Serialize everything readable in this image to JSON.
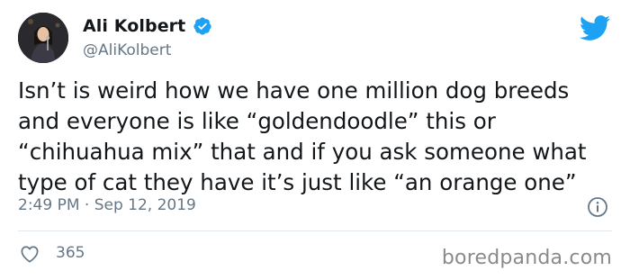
{
  "author": {
    "display_name": "Ali Kolbert",
    "handle": "@AliKolbert",
    "verified": true
  },
  "tweet": {
    "text": "Isn’t is weird how we have one million dog breeds\nand everyone is like “goldendoodle” this or\n“chihuahua mix” that and if you ask someone what\ntype of cat they have it’s just like “an orange one”",
    "timestamp": "2:49 PM · Sep 12, 2019",
    "like_count": "365"
  },
  "watermark": "boredpanda.com",
  "icons": {
    "brand": "twitter-bird-icon",
    "verified": "verified-badge-icon",
    "info": "info-icon",
    "like": "heart-icon"
  },
  "colors": {
    "twitter_blue": "#1da1f2",
    "text_primary": "#14171a",
    "text_secondary": "#657786",
    "divider": "#e1e8ed"
  }
}
